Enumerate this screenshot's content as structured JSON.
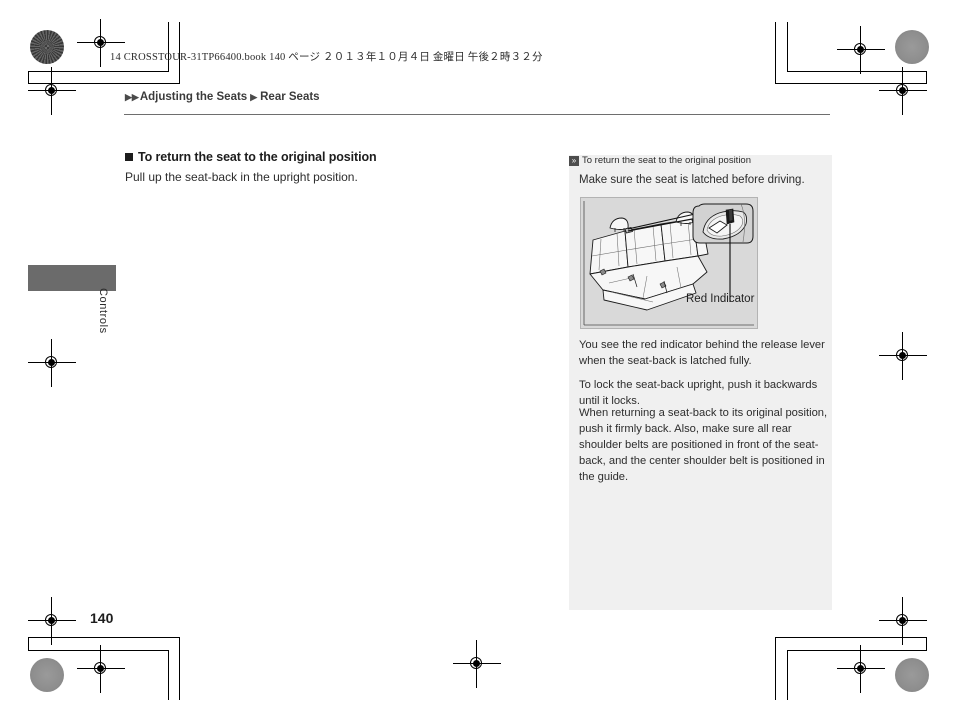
{
  "doc_header": {
    "book_file": "14 CROSSTOUR-31TP66400.book",
    "page_marker": "140 ページ",
    "date_jp": "２０１３年１０月４日",
    "weekday_jp": "金曜日",
    "time_jp": "午後２時３２分",
    "full_line": "14 CROSSTOUR-31TP66400.book   140 ページ   ２０１３年１０月４日   金曜日   午後２時３２分"
  },
  "breadcrumb": {
    "marker_double": "▶▶",
    "marker_single": "▶",
    "items": [
      {
        "label": "Adjusting the Seats"
      },
      {
        "label": "Rear Seats"
      }
    ]
  },
  "thumb_tab": {
    "label": "Controls",
    "block_color": "#6b6b6b"
  },
  "main": {
    "heading": "To return the seat to the original position",
    "body": "Pull up the seat-back in the upright position."
  },
  "side_panel": {
    "bg_color": "#f0f0f0",
    "chevron_glyph": "»",
    "heading": "To return the seat to the original position",
    "subheading": "Make sure the seat is latched before driving.",
    "figure": {
      "caption": "Red Indicator",
      "alt_name": "rear-seat-red-indicator-illustration",
      "bg_color": "#d9d9d9"
    },
    "paragraphs": [
      "You see the red indicator behind the release lever when the seat-back is latched fully.",
      "To lock the seat-back upright, push it backwards until it locks.",
      "When returning a seat-back to its original position, push it firmly back. Also, make sure all rear shoulder belts are positioned in front of the seat-back, and the center shoulder belt is positioned in the guide."
    ]
  },
  "footer": {
    "page_number": "140"
  }
}
